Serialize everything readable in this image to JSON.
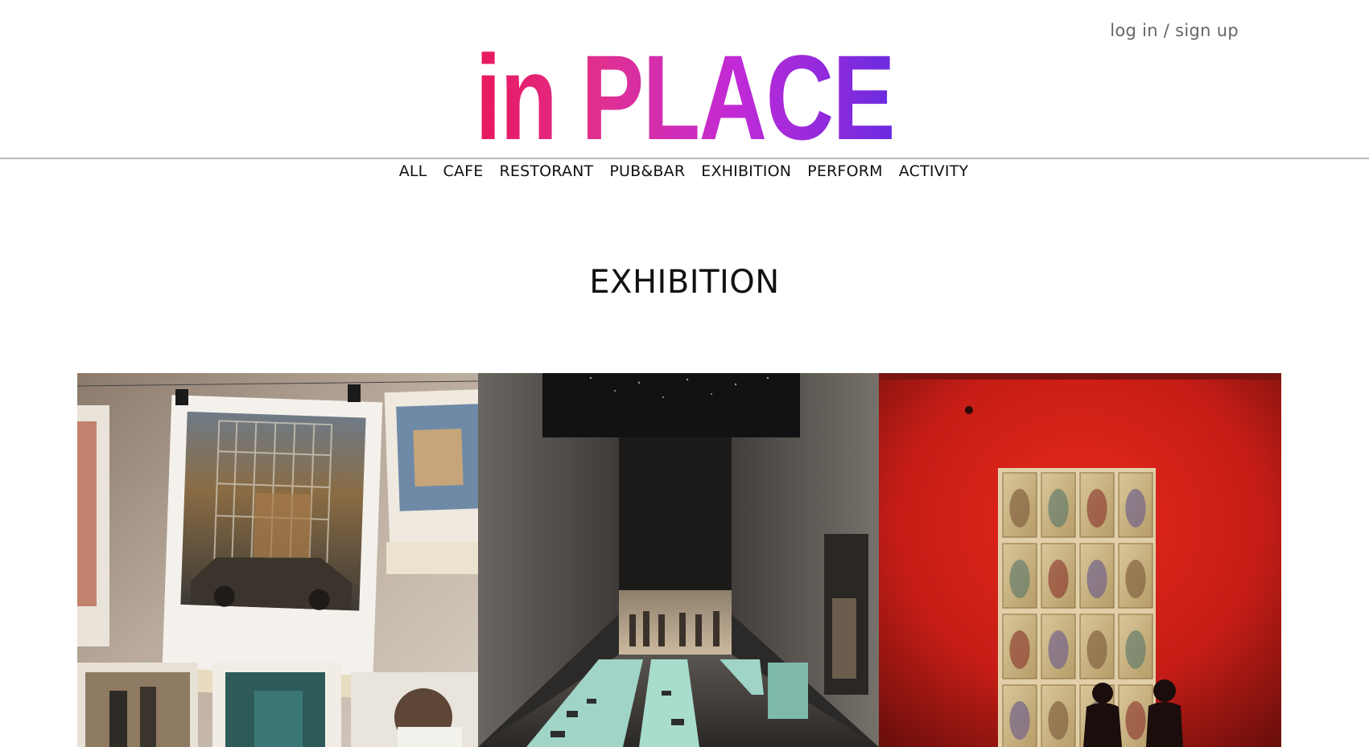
{
  "header": {
    "auth_link": "log in / sign up",
    "logo_text": "in PLACE"
  },
  "nav": {
    "items": [
      {
        "label": "ALL"
      },
      {
        "label": "CAFE"
      },
      {
        "label": "RESTORANT"
      },
      {
        "label": "PUB&BAR"
      },
      {
        "label": "EXHIBITION"
      },
      {
        "label": "PERFORM"
      },
      {
        "label": "ACTIVITY"
      }
    ]
  },
  "main": {
    "title": "EXHIBITION"
  },
  "colors": {
    "logo_gradient": [
      "#e8185e",
      "#c22ad7",
      "#6a2be0"
    ],
    "divider": "#b9b9b9",
    "red_wall": "#d8231c"
  }
}
